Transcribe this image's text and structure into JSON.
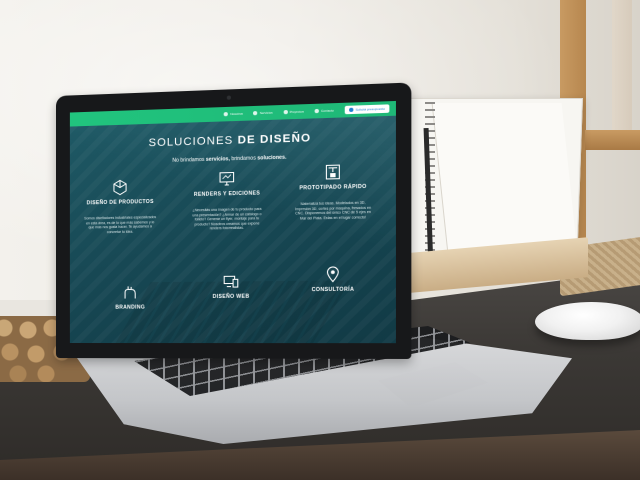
{
  "site": {
    "nav": [
      {
        "label": "Nosotros",
        "icon": "users-icon"
      },
      {
        "label": "Servicios",
        "icon": "gear-icon"
      },
      {
        "label": "Proyectos",
        "icon": "folder-icon"
      },
      {
        "label": "Contacto",
        "icon": "mail-icon"
      }
    ],
    "cta": {
      "label": "Solicitá presupuesto",
      "icon": "search-icon"
    },
    "title_light": "SOLUCIONES",
    "title_bold": "DE DISEÑO",
    "subtitle_a": "No brindamos",
    "subtitle_b": "servicios,",
    "subtitle_c": "brindamos",
    "subtitle_d": "soluciones.",
    "services": [
      {
        "name": "DISEÑO DE PRODUCTOS",
        "icon": "cube-icon",
        "desc": "Somos diseñadores industriales especializados en esta área, es de lo que más sabemos y lo que más nos gusta hacer. Te ayudamos a concretar tu idea."
      },
      {
        "name": "RENDERS Y EDICIONES",
        "icon": "monitor-icon",
        "desc": "¿Necesitás una imagen de tu producto para una presentación? ¿Armar de un catálogo o folleto? Generar un flyer, montaje para tu producto? Nosotros creamos que expone renders fotorrealistas."
      },
      {
        "name": "PROTOTIPADO RÁPIDO",
        "icon": "printer-3d-icon",
        "desc": "Materializá tus ideas. Modelados en 3D, impresión 3D, cortes por máquina, fresados en CNC. Disponemos del único CNC de 5 ejes en Mar del Plata. Estas en el lugar correcto!"
      },
      {
        "name": "BRANDING",
        "icon": "hand-icon",
        "desc": ""
      },
      {
        "name": "DISEÑO WEB",
        "icon": "devices-icon",
        "desc": ""
      },
      {
        "name": "CONSULTORÍA",
        "icon": "pin-icon",
        "desc": ""
      }
    ],
    "colors": {
      "topbar": "#21c47e",
      "overlay": "#174854",
      "cta_text": "#1f7fd1"
    }
  }
}
